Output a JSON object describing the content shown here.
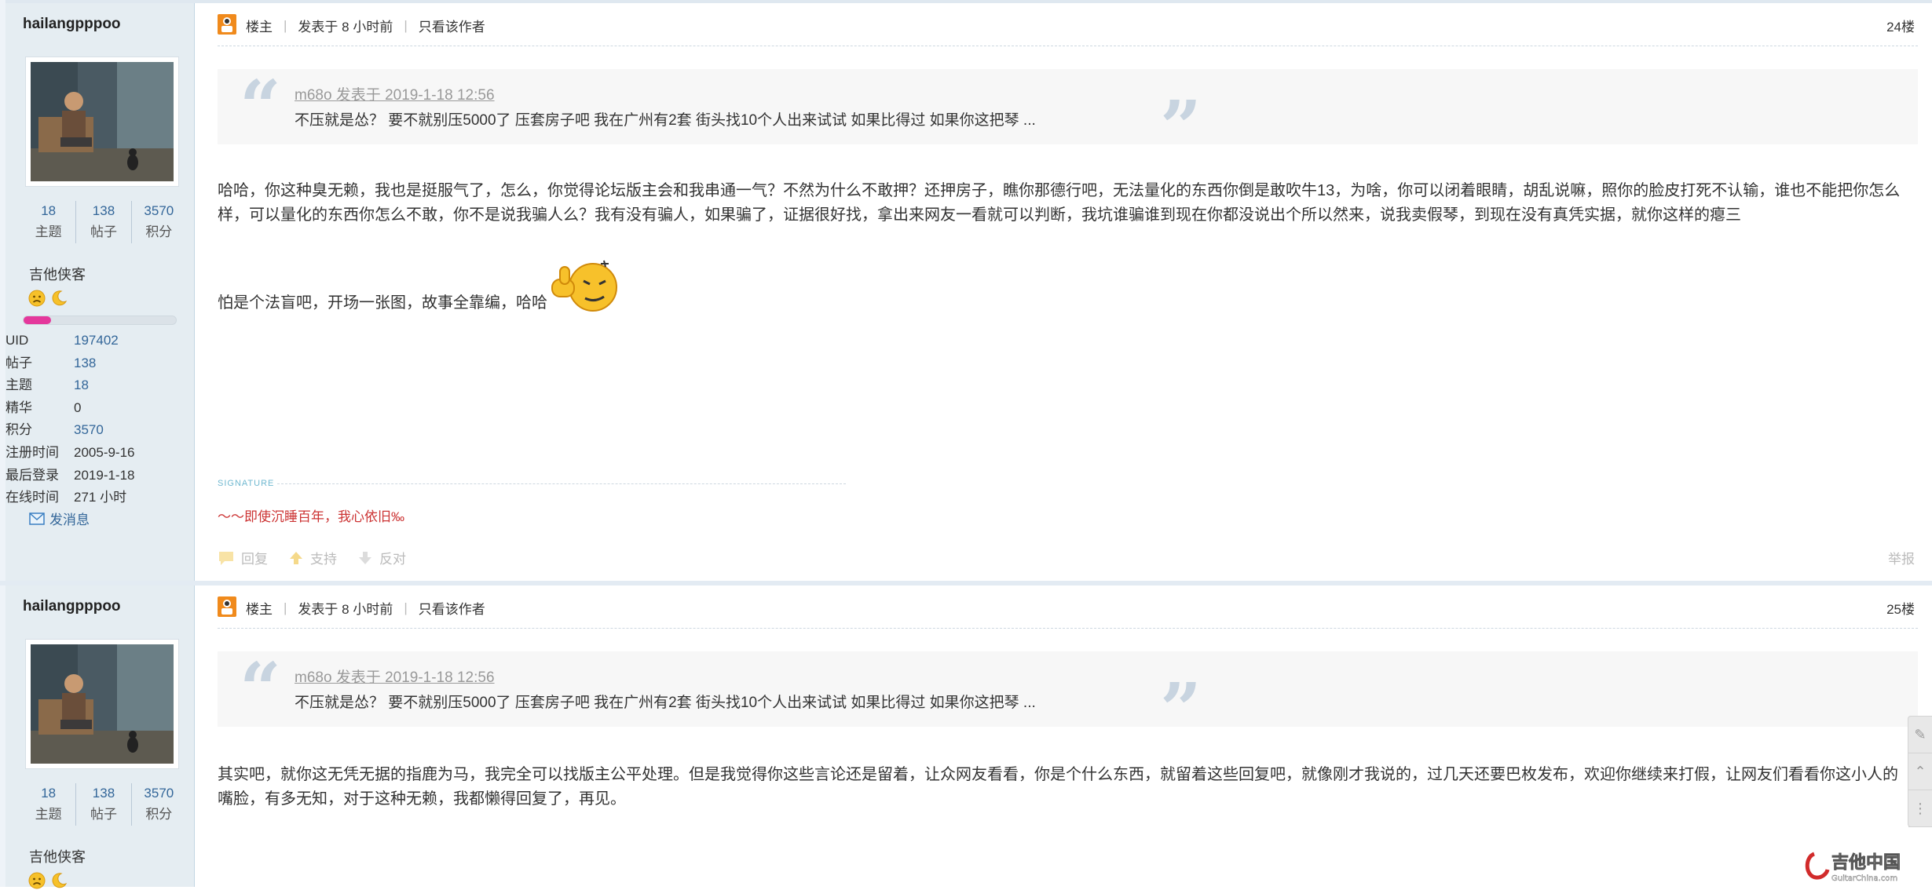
{
  "posts": [
    {
      "user": {
        "name": "hailangpppoo",
        "stats": [
          {
            "num": "18",
            "label": "主题"
          },
          {
            "num": "138",
            "label": "帖子"
          },
          {
            "num": "3570",
            "label": "积分"
          }
        ],
        "group": "吉他侠客",
        "level_progress": 0.18,
        "info": [
          {
            "k": "UID",
            "v": "197402"
          },
          {
            "k": "帖子",
            "v": "138"
          },
          {
            "k": "主题",
            "v": "18"
          },
          {
            "k": "精华",
            "v": "0"
          },
          {
            "k": "积分",
            "v": "3570"
          },
          {
            "k": "注册时间",
            "v": "2005-9-16"
          },
          {
            "k": "最后登录",
            "v": "2019-1-18"
          },
          {
            "k": "在线时间",
            "v": "271 小时"
          }
        ],
        "send_message": "发消息"
      },
      "header": {
        "role": "楼主",
        "posted": "发表于 8 小时前",
        "only_author": "只看该作者",
        "floor": "24楼"
      },
      "quote": {
        "by": "m68o 发表于 2019-1-18 12:56",
        "text": "不压就是怂？ 要不就别压5000了 压套房子吧 我在广州有2套 街头找10个人出来试试 如果比得过 如果你这把琴 ..."
      },
      "content": "哈哈，你这种臭无赖，我也是挺服气了，怎么，你觉得论坛版主会和我串通一气？不然为什么不敢押？还押房子，瞧你那德行吧，无法量化的东西你倒是敢吹牛13，为啥，你可以闭着眼睛，胡乱说嘛，照你的脸皮打死不认输，谁也不能把你怎么样，可以量化的东西你怎么不敢，你不是说我骗人么？我有没有骗人，如果骗了，证据很好找，拿出来网友一看就可以判断，我坑谁骗谁到现在你都没说出个所以然来，说我卖假琴，到现在没有真凭实据，就你这样的瘪三",
      "content_tail": "怕是个法盲吧，开场一张图，故事全靠编，哈哈",
      "signature_label": "SIGNATURE",
      "signature": "～～即使沉睡百年，我心依旧‰",
      "actions": {
        "reply": "回复",
        "support": "支持",
        "oppose": "反对",
        "report": "举报"
      }
    },
    {
      "user": {
        "name": "hailangpppoo",
        "stats": [
          {
            "num": "18",
            "label": "主题"
          },
          {
            "num": "138",
            "label": "帖子"
          },
          {
            "num": "3570",
            "label": "积分"
          }
        ],
        "group": "吉他侠客"
      },
      "header": {
        "role": "楼主",
        "posted": "发表于 8 小时前",
        "only_author": "只看该作者",
        "floor": "25楼"
      },
      "quote": {
        "by": "m68o 发表于 2019-1-18 12:56",
        "text": "不压就是怂？ 要不就别压5000了 压套房子吧 我在广州有2套 街头找10个人出来试试 如果比得过 如果你这把琴 ..."
      },
      "content": "其实吧，就你这无凭无据的指鹿为马，我完全可以找版主公平处理。但是我觉得你这些言论还是留着，让众网友看看，你是个什么东西，就留着这些回复吧，就像刚才我说的，过几天还要巴枚发布，欢迎你继续来打假，让网友们看看你这小人的嘴脸，有多无知，对于这种无赖，我都懒得回复了，再见。"
    }
  ],
  "watermark": {
    "brand": "吉他中国",
    "site": "GuitarChina.com"
  },
  "colors": {
    "link": "#336699",
    "signature": "#cc3333",
    "progress": "#e4389c",
    "sidebar_bg": "#e5edf2"
  }
}
